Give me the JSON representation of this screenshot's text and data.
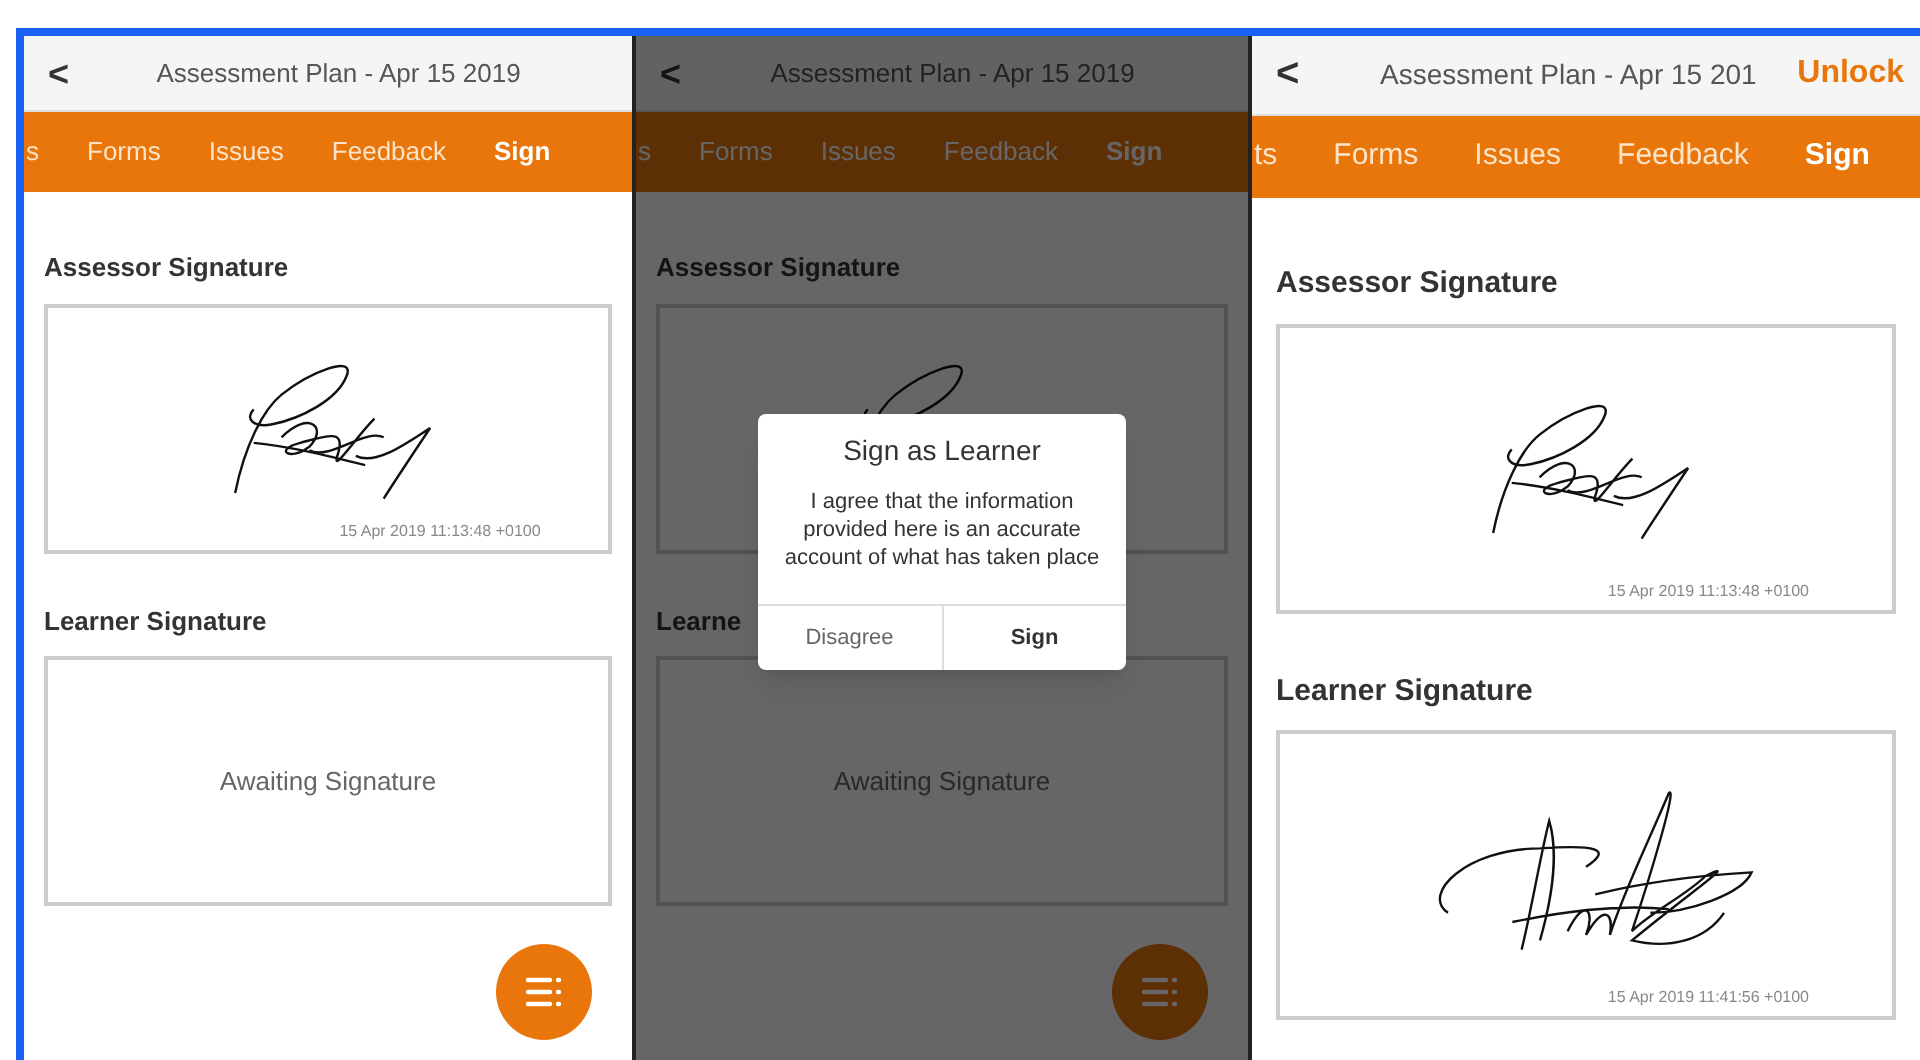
{
  "screens": [
    {
      "header": {
        "back": "<",
        "title": "Assessment Plan - Apr 15 2019"
      },
      "tabs": [
        {
          "label": "s",
          "selected": false
        },
        {
          "label": "Forms",
          "selected": false
        },
        {
          "label": "Issues",
          "selected": false
        },
        {
          "label": "Feedback",
          "selected": false
        },
        {
          "label": "Sign",
          "selected": true
        }
      ],
      "sections": [
        {
          "heading": "Assessor Signature",
          "kind": "signed",
          "timestamp": "15 Apr 2019 11:13:48 +0100"
        },
        {
          "heading": "Learner Signature",
          "kind": "awaiting",
          "placeholder": "Awaiting Signature"
        }
      ],
      "fab": true,
      "dimmed": false
    },
    {
      "header": {
        "back": "<",
        "title": "Assessment Plan - Apr 15 2019"
      },
      "tabs": [
        {
          "label": "s",
          "selected": false
        },
        {
          "label": "Forms",
          "selected": false
        },
        {
          "label": "Issues",
          "selected": false
        },
        {
          "label": "Feedback",
          "selected": false
        },
        {
          "label": "Sign",
          "selected": true
        }
      ],
      "sections": [
        {
          "heading": "Assessor Signature",
          "kind": "signed"
        },
        {
          "heading": "Learne",
          "kind": "awaiting",
          "placeholder": "Awaiting Signature"
        }
      ],
      "fab": true,
      "dimmed": true,
      "dialog": {
        "title": "Sign as Learner",
        "message": "I agree that the information provided here is an accurate account of what has taken place",
        "buttons": [
          {
            "label": "Disagree",
            "primary": false
          },
          {
            "label": "Sign",
            "primary": true
          }
        ]
      }
    },
    {
      "header": {
        "back": "<",
        "title": "Assessment Plan - Apr 15 201",
        "action": "Unlock"
      },
      "tabs": [
        {
          "label": "ts",
          "selected": false
        },
        {
          "label": "Forms",
          "selected": false
        },
        {
          "label": "Issues",
          "selected": false
        },
        {
          "label": "Feedback",
          "selected": false
        },
        {
          "label": "Sign",
          "selected": true
        }
      ],
      "sections": [
        {
          "heading": "Assessor Signature",
          "kind": "signed",
          "timestamp": "15 Apr 2019 11:13:48 +0100"
        },
        {
          "heading": "Learner Signature",
          "kind": "signed",
          "timestamp": "15 Apr 2019 11:41:56 +0100"
        }
      ],
      "fab": false,
      "dimmed": false
    }
  ]
}
